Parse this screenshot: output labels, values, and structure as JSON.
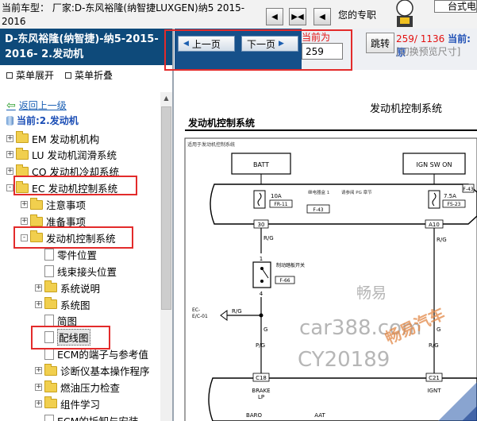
{
  "topbar": {
    "model_text": "当前车型：  厂家:D-东风裕隆(纳智捷LUXGEN)纳5 2015-2016",
    "profession_text": "您的专职",
    "brand_text": "台式电"
  },
  "left_panel": {
    "header": "D-东风裕隆(纳智捷)-纳5-2015-2016- 2.发动机",
    "menu_expand": "菜单展开",
    "menu_collapse": "菜单折叠",
    "back_link": "返回上一级",
    "current_node": "当前:2.发动机",
    "tree": [
      {
        "label": "EM 发动机机构",
        "level": 0,
        "type": "folder",
        "expander": "+"
      },
      {
        "label": "LU 发动机润滑系统",
        "level": 0,
        "type": "folder",
        "expander": "+"
      },
      {
        "label": "CO 发动机冷却系统",
        "level": 0,
        "type": "folder",
        "expander": "+"
      },
      {
        "label": "EC 发动机控制系统",
        "level": 0,
        "type": "folder",
        "expander": "-"
      },
      {
        "label": "注意事项",
        "level": 1,
        "type": "folder",
        "expander": "+"
      },
      {
        "label": "准备事项",
        "level": 1,
        "type": "folder",
        "expander": "+"
      },
      {
        "label": "发动机控制系统",
        "level": 1,
        "type": "folder",
        "expander": "-"
      },
      {
        "label": "零件位置",
        "level": 2,
        "type": "doc",
        "expander": ""
      },
      {
        "label": "线束接头位置",
        "level": 2,
        "type": "doc",
        "expander": ""
      },
      {
        "label": "系统说明",
        "level": 2,
        "type": "folder",
        "expander": "+"
      },
      {
        "label": "系统图",
        "level": 2,
        "type": "folder",
        "expander": "+"
      },
      {
        "label": "简图",
        "level": 2,
        "type": "doc",
        "expander": ""
      },
      {
        "label": "配线图",
        "level": 2,
        "type": "doc",
        "expander": "",
        "selected": true
      },
      {
        "label": "ECM的端子与参考值",
        "level": 2,
        "type": "doc",
        "expander": ""
      },
      {
        "label": "诊断仪基本操作程序",
        "level": 2,
        "type": "folder",
        "expander": "+"
      },
      {
        "label": "燃油压力检查",
        "level": 2,
        "type": "folder",
        "expander": "+"
      },
      {
        "label": "组件学习",
        "level": 2,
        "type": "folder",
        "expander": "+"
      },
      {
        "label": "ECM的拆卸与安装",
        "level": 2,
        "type": "doc",
        "expander": ""
      }
    ]
  },
  "toolbar": {
    "prev_page": "上一页",
    "next_page": "下一页",
    "current_label": "当前为",
    "page_value": "259",
    "jump": "跳转",
    "page_current": "259",
    "page_total": "1136",
    "current_suffix": "当前:原",
    "preview_size": "[切换预览尺寸]"
  },
  "diagram": {
    "title": "发动机控制系统",
    "section_title": "发动机控制系统",
    "small_header": "适用于发动机控制系统",
    "batt": "BATT",
    "ign": "IGN SW ON",
    "fuse1_amp": "10A",
    "fuse1_code": "FR-11",
    "fuse1_conn": "F-43",
    "fuse2_amp": "7.5A",
    "fuse2_code": "FS-23",
    "fuse2_conn": "F-43",
    "relay_note1": "继电器盒 1",
    "relay_note2": "请参阅 PG 章节",
    "pin30": "30",
    "pinA10": "A10",
    "wire_rg": "R/G",
    "switch_note": "制动踏板开关",
    "switch_conn": "F-66",
    "pin1": "1",
    "pin4": "4",
    "ec_ref1": "EC-",
    "ec_ref2": "E/C-01",
    "wire_g": "G",
    "wire_pg": "P/G",
    "wire_rg2": "R/G",
    "c18": "C18",
    "c21": "C21",
    "brake": "BRAKE",
    "lp": "LP",
    "ignt": "IGNT",
    "baro": "BARO",
    "aat": "AAT"
  },
  "watermarks": {
    "w1": "畅易",
    "w2": "car388.com",
    "w3": "CY20189",
    "w4": "畅易汽车"
  }
}
